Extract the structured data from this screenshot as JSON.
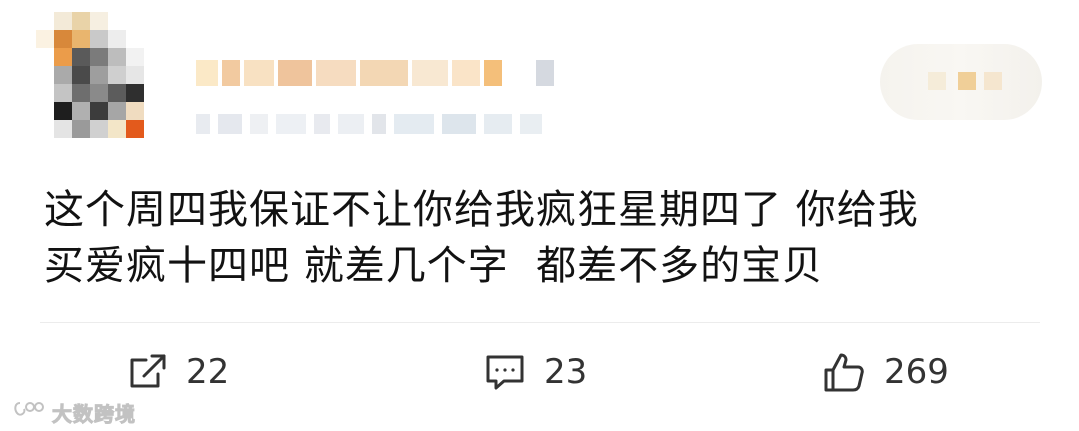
{
  "post": {
    "text_line1": "这个周四我保证不让你给我疯狂星期四了 你给我",
    "text_line2": "买爱疯十四吧 就差几个字  都差不多的宝贝"
  },
  "actions": {
    "repost_count": "22",
    "comment_count": "23",
    "like_count": "269"
  },
  "watermark": {
    "text": "大数跨境"
  },
  "icons": {
    "repost": "share-arrow-icon",
    "comment": "comment-bubble-icon",
    "like": "thumbs-up-icon",
    "watermark": "watermark-logo-icon"
  },
  "colors": {
    "text": "#121212",
    "icon": "#333333",
    "divider": "#ececec"
  }
}
